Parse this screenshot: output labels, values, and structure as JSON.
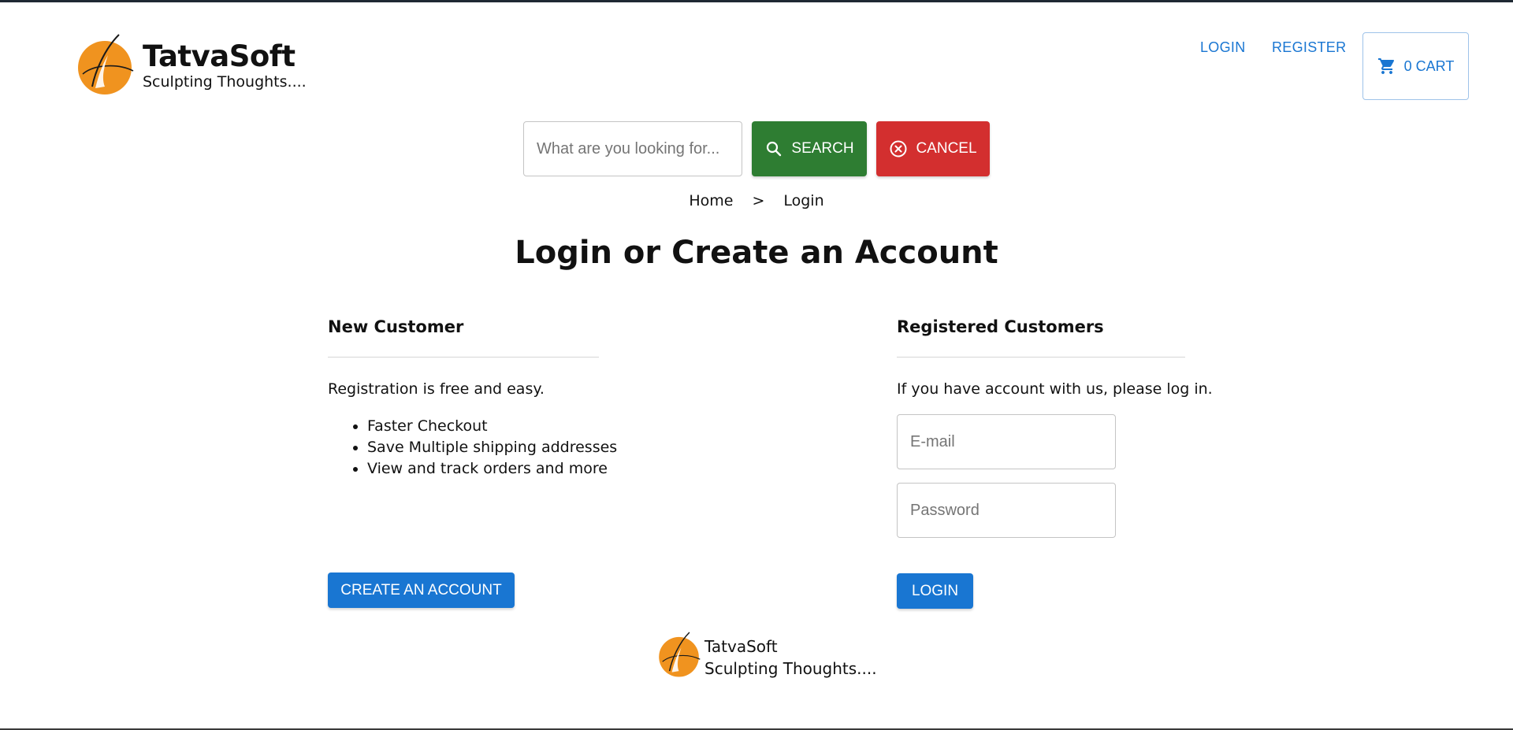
{
  "brand": {
    "name": "TatvaSoft",
    "tagline": "Sculpting Thoughts....",
    "accent_color": "#f39c12",
    "logo_icon": "orange-sphere-swoosh-logo"
  },
  "header": {
    "nav": {
      "login_label": "LOGIN",
      "register_label": "REGISTER"
    },
    "cart": {
      "icon": "shopping-cart-icon",
      "label": "0 CART"
    }
  },
  "search": {
    "placeholder": "What are you looking for...",
    "value": "",
    "search_label": "SEARCH",
    "search_icon": "search-icon",
    "cancel_label": "CANCEL",
    "cancel_icon": "cancel-circle-icon"
  },
  "breadcrumb": {
    "home": "Home",
    "separator": ">",
    "current": "Login"
  },
  "page": {
    "title": "Login or Create an Account"
  },
  "new_customer": {
    "title": "New Customer",
    "intro": "Registration is free and easy.",
    "benefits": [
      "Faster Checkout",
      "Save Multiple shipping addresses",
      "View and track orders and more"
    ],
    "button_label": "CREATE AN ACCOUNT"
  },
  "registered_customer": {
    "title": "Registered Customers",
    "intro": "If you have account with us, please log in.",
    "email_placeholder": "E-mail",
    "email_value": "",
    "password_placeholder": "Password",
    "password_value": "",
    "button_label": "LOGIN"
  },
  "footer": {
    "name": "TatvaSoft",
    "tagline": "Sculpting Thoughts...."
  },
  "colors": {
    "primary": "#1976d2",
    "success": "#2e7d32",
    "danger": "#d32f2f",
    "logo_orange": "#f39c12"
  }
}
